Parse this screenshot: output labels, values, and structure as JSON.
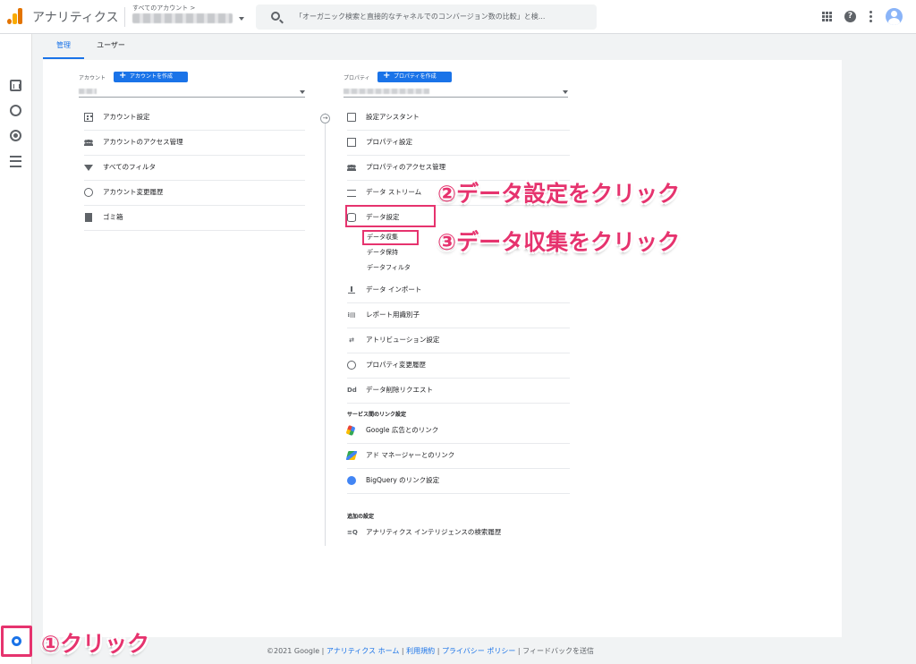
{
  "topbar": {
    "app_title": "アナリティクス",
    "account_crumb": "すべてのアカウント >",
    "search_placeholder": "「オーガニック検索と直接的なチャネルでのコンバージョン数の比較」と検..."
  },
  "leftnav": {
    "items": [
      {
        "icon": "bar-chart-icon",
        "label": "レポート"
      },
      {
        "icon": "explore-icon",
        "label": "探索"
      },
      {
        "icon": "advertising-icon",
        "label": "広告"
      },
      {
        "icon": "configure-icon",
        "label": "設定"
      }
    ],
    "admin_icon": "gear-icon"
  },
  "tabs": {
    "admin": "管理",
    "user": "ユーザー"
  },
  "account_column": {
    "label": "アカウント",
    "create_button": "アカウントを作成",
    "items": [
      {
        "icon": "building-icon",
        "label": "アカウント設定"
      },
      {
        "icon": "people-icon",
        "label": "アカウントのアクセス管理"
      },
      {
        "icon": "filter-icon",
        "label": "すべてのフィルタ"
      },
      {
        "icon": "history-icon",
        "label": "アカウント変更履歴"
      },
      {
        "icon": "trash-icon",
        "label": "ゴミ箱"
      }
    ]
  },
  "property_column": {
    "label": "プロパティ",
    "create_button": "プロパティを作成",
    "items": [
      {
        "icon": "checkbox-icon",
        "label": "設定アシスタント"
      },
      {
        "icon": "page-icon",
        "label": "プロパティ設定"
      },
      {
        "icon": "people-icon",
        "label": "プロパティのアクセス管理"
      },
      {
        "icon": "stream-icon",
        "label": "データ ストリーム"
      },
      {
        "icon": "database-icon",
        "label": "データ設定"
      }
    ],
    "data_settings_sub": [
      "データ収集",
      "データ保持",
      "データフィルタ"
    ],
    "items2": [
      {
        "icon": "upload-icon",
        "label": "データ インポート"
      },
      {
        "icon": "report-id-icon",
        "label": "レポート用識別子"
      },
      {
        "icon": "attribution-icon",
        "label": "アトリビューション設定"
      },
      {
        "icon": "history-icon",
        "label": "プロパティ変更履歴"
      },
      {
        "icon": "dd-icon",
        "label": "データ削除リクエスト"
      }
    ],
    "links_section": "サービス間のリンク設定",
    "links": [
      {
        "icon": "google-ads-icon",
        "label": "Google 広告とのリンク"
      },
      {
        "icon": "ad-manager-icon",
        "label": "アド マネージャーとのリンク"
      },
      {
        "icon": "bigquery-icon",
        "label": "BigQuery のリンク設定"
      }
    ],
    "extra_section": "追加の設定",
    "extra": [
      {
        "icon": "search-history-icon",
        "label": "アナリティクス インテリジェンスの検索履歴"
      }
    ]
  },
  "annotations": {
    "step1": "①クリック",
    "step2": "②データ設定をクリック",
    "step3": "③データ収集をクリック",
    "color": "#e6336e"
  },
  "footer": {
    "copyright": "©2021 Google |",
    "home": "アナリティクス ホーム",
    "sep1": "|",
    "terms": "利用規約",
    "sep2": "|",
    "privacy": "プライバシー ポリシー",
    "sep3": "|",
    "feedback": "フィードバックを送信"
  }
}
